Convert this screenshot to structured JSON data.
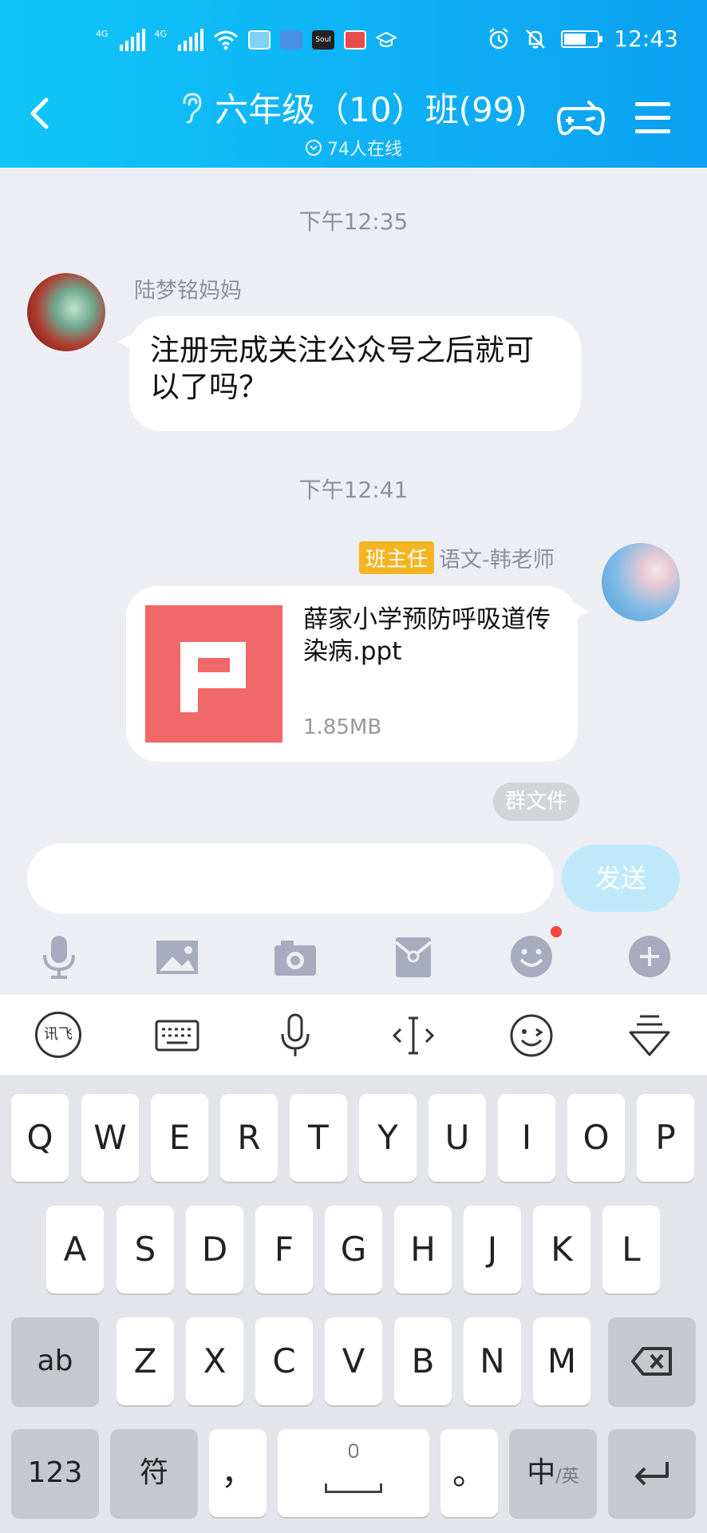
{
  "status_bar": {
    "net1": "4G",
    "net2": "4G",
    "app_soul": "Soul",
    "time": "12:43"
  },
  "header": {
    "title": "六年级（10）班(99)",
    "online": "74人在线"
  },
  "messages": [
    {
      "time": "下午12:35",
      "sender": "陆梦铭妈妈",
      "text": "注册完成关注公众号之后就可以了吗？"
    },
    {
      "time": "下午12:41",
      "badge": "班主任",
      "sender": "语文-韩老师",
      "file": {
        "name": "薛家小学预防呼吸道传染病.ppt",
        "size": "1.85MB",
        "icon_letter": "P"
      }
    }
  ],
  "group_files_label": "群文件",
  "composer": {
    "placeholder": "",
    "send": "发送"
  },
  "toolbar_icons": [
    "mic-icon",
    "image-icon",
    "camera-icon",
    "red-packet-icon",
    "emoji-icon",
    "plus-icon"
  ],
  "ime_icons": [
    "xunfei-logo-icon",
    "keyboard-icon",
    "voice-input-icon",
    "cursor-move-icon",
    "emoticon-icon",
    "hide-keyboard-icon"
  ],
  "ime_logo": "讯飞",
  "keyboard": {
    "row1": [
      "Q",
      "W",
      "E",
      "R",
      "T",
      "Y",
      "U",
      "I",
      "O",
      "P"
    ],
    "row2": [
      "A",
      "S",
      "D",
      "F",
      "G",
      "H",
      "J",
      "K",
      "L"
    ],
    "row3": [
      "Z",
      "X",
      "C",
      "V",
      "B",
      "N",
      "M"
    ],
    "shift": "ab",
    "num": "123",
    "symbol": "符",
    "comma": "，",
    "period": "。",
    "lang_main": "中",
    "lang_sub": "/英"
  },
  "colors": {
    "header_start": "#10c6f8",
    "header_end": "#0ca0f0",
    "badge": "#f5b522",
    "ppt": "#f06868",
    "send_disabled": "#bfe9fb",
    "icon_gray": "#a7abbd"
  }
}
